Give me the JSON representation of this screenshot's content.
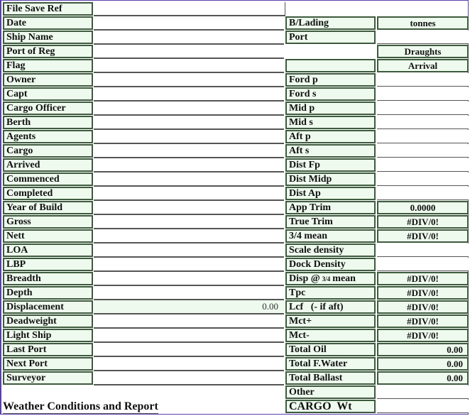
{
  "left_fields": [
    {
      "label": "File Save Ref",
      "value": ""
    },
    {
      "label": "Date",
      "value": ""
    },
    {
      "label": "Ship Name",
      "value": ""
    },
    {
      "label": "Port of Reg",
      "value": ""
    },
    {
      "label": "Flag",
      "value": ""
    },
    {
      "label": "Owner",
      "value": ""
    },
    {
      "label": "Capt",
      "value": ""
    },
    {
      "label": "Cargo Officer",
      "value": ""
    },
    {
      "label": "Berth",
      "value": ""
    },
    {
      "label": "Agents",
      "value": ""
    },
    {
      "label": "Cargo",
      "value": ""
    },
    {
      "label": "Arrived",
      "value": ""
    },
    {
      "label": "Commenced",
      "value": ""
    },
    {
      "label": "Completed",
      "value": ""
    },
    {
      "label": "Year of Build",
      "value": ""
    },
    {
      "label": "Gross",
      "value": ""
    },
    {
      "label": "Nett",
      "value": ""
    },
    {
      "label": "LOA",
      "value": ""
    },
    {
      "label": "LBP",
      "value": ""
    },
    {
      "label": "Breadth",
      "value": ""
    },
    {
      "label": "Depth",
      "value": ""
    },
    {
      "label": "Displacement",
      "value": "0.00"
    },
    {
      "label": "Deadweight",
      "value": ""
    },
    {
      "label": "Light Ship",
      "value": ""
    },
    {
      "label": "Last Port",
      "value": ""
    },
    {
      "label": "Next Port",
      "value": ""
    },
    {
      "label": "Surveyor",
      "value": ""
    }
  ],
  "right_fields": [
    {
      "label": "B/Lading",
      "value": "tonnes"
    },
    {
      "label": "Port",
      "value": ""
    },
    {
      "label": "",
      "value": "Draughts"
    },
    {
      "label": "",
      "value": "Arrival"
    },
    {
      "label": "Ford p",
      "value": ""
    },
    {
      "label": "Ford s",
      "value": ""
    },
    {
      "label": "Mid p",
      "value": ""
    },
    {
      "label": "Mid s",
      "value": ""
    },
    {
      "label": "Aft p",
      "value": ""
    },
    {
      "label": "Aft s",
      "value": ""
    },
    {
      "label": "Dist Fp",
      "value": ""
    },
    {
      "label": "Dist Midp",
      "value": ""
    },
    {
      "label": "Dist Ap",
      "value": ""
    },
    {
      "label": "App Trim",
      "value": "0.0000"
    },
    {
      "label": "True Trim",
      "value": "#DIV/0!"
    },
    {
      "label": "3/4 mean",
      "value": "#DIV/0!"
    },
    {
      "label": "Scale density",
      "value": ""
    },
    {
      "label": "Dock Density",
      "value": ""
    },
    {
      "label": "Disp @",
      "label_small": "3/4",
      "label_suffix": "mean",
      "value": "#DIV/0!"
    },
    {
      "label": "Tpc",
      "value": "#DIV/0!"
    },
    {
      "label": "Lcf   (- if aft)",
      "value": "#DIV/0!"
    },
    {
      "label": "Mct+",
      "value": "#DIV/0!"
    },
    {
      "label": "Mct-",
      "value": "#DIV/0!"
    },
    {
      "label": "Total Oil",
      "value": "0.00"
    },
    {
      "label": "Total F.Water",
      "value": "0.00"
    },
    {
      "label": "Total Ballast",
      "value": "0.00"
    },
    {
      "label": "Other",
      "value": ""
    },
    {
      "label": "CARGO  Wt",
      "value": ""
    }
  ],
  "section_heading": "Weather Conditions and Report"
}
